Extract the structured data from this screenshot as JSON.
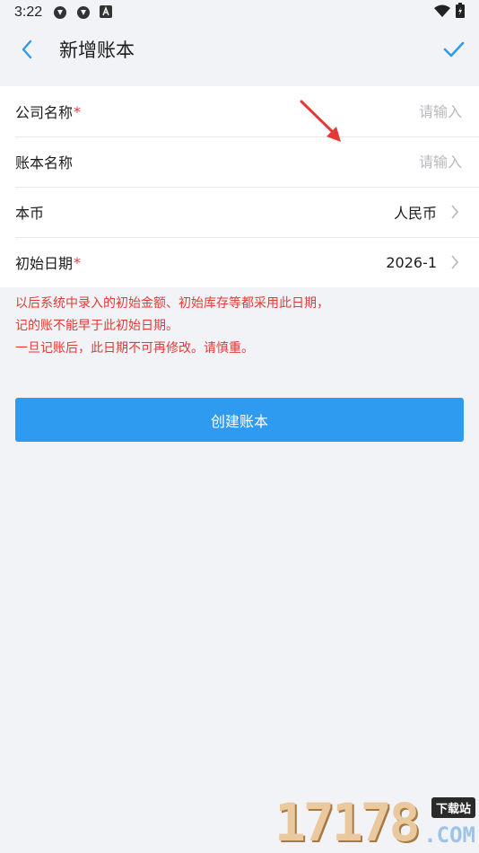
{
  "status_bar": {
    "time": "3:22",
    "icons": [
      "sync-icon",
      "sync-icon",
      "font-icon"
    ],
    "right_icons": [
      "wifi-icon",
      "battery-icon"
    ]
  },
  "nav": {
    "title": "新增账本",
    "back_icon": "chevron-left-icon",
    "confirm_icon": "check-icon",
    "accent": "#2f9bf0"
  },
  "form": {
    "company_name": {
      "label": "公司名称",
      "required_mark": "*",
      "placeholder": "请输入",
      "value": ""
    },
    "book_name": {
      "label": "账本名称",
      "placeholder": "请输入",
      "value": ""
    },
    "currency": {
      "label": "本币",
      "value": "人民币"
    },
    "start_date": {
      "label": "初始日期",
      "required_mark": "*",
      "value": "2026-1"
    }
  },
  "notice": {
    "line1": "以后系统中录入的初始金额、初始库存等都采用此日期，",
    "line2": "记的账不能早于此初始日期。",
    "line3": "一旦记账后，此日期不可再修改。请慎重。",
    "color": "#e53935"
  },
  "actions": {
    "create_label": "创建账本"
  },
  "watermark": {
    "number": "17178",
    "badge": "下载站",
    "domain": ".COM"
  }
}
